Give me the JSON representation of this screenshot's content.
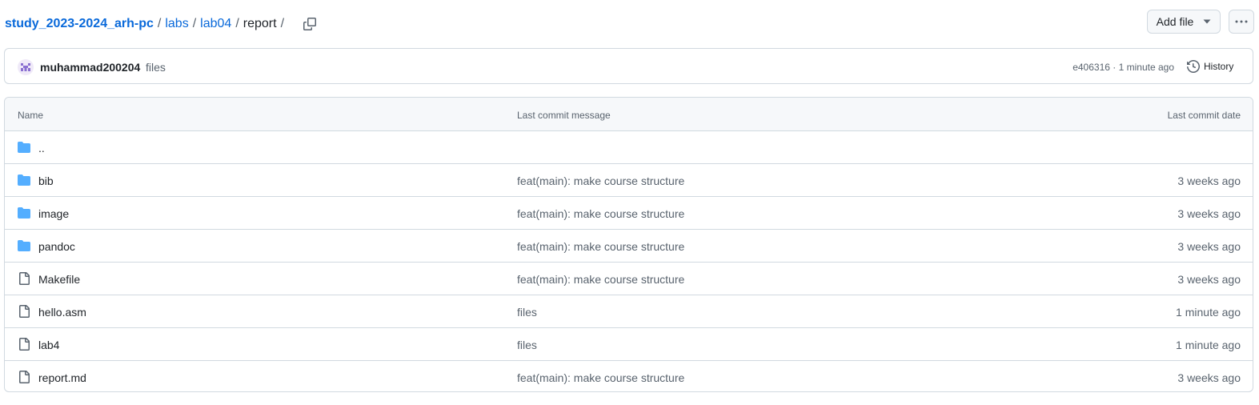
{
  "breadcrumb": {
    "repo": "study_2023-2024_arh-pc",
    "segments": [
      "labs",
      "lab04"
    ],
    "current": "report",
    "separator": "/",
    "trailing_separator": "/"
  },
  "toolbar": {
    "add_file_label": "Add file"
  },
  "commit": {
    "author": "muhammad200204",
    "message": "files",
    "sha": "e406316",
    "separator": "·",
    "time": "1 minute ago",
    "history_label": "History"
  },
  "table": {
    "columns": {
      "name": "Name",
      "message": "Last commit message",
      "date": "Last commit date"
    },
    "rows": [
      {
        "type": "folder",
        "name": "..",
        "message": "",
        "date": ""
      },
      {
        "type": "folder",
        "name": "bib",
        "message": "feat(main): make course structure",
        "date": "3 weeks ago"
      },
      {
        "type": "folder",
        "name": "image",
        "message": "feat(main): make course structure",
        "date": "3 weeks ago"
      },
      {
        "type": "folder",
        "name": "pandoc",
        "message": "feat(main): make course structure",
        "date": "3 weeks ago"
      },
      {
        "type": "file",
        "name": "Makefile",
        "message": "feat(main): make course structure",
        "date": "3 weeks ago"
      },
      {
        "type": "file",
        "name": "hello.asm",
        "message": "files",
        "date": "1 minute ago"
      },
      {
        "type": "file",
        "name": "lab4",
        "message": "files",
        "date": "1 minute ago"
      },
      {
        "type": "file",
        "name": "report.md",
        "message": "feat(main): make course structure",
        "date": "3 weeks ago"
      }
    ]
  },
  "icons": {
    "folder": "folder-icon",
    "file": "file-icon",
    "copy": "copy-icon",
    "history": "history-icon",
    "caret": "caret-down-icon",
    "more": "kebab-horizontal-icon"
  },
  "colors": {
    "link": "#0969da",
    "folder": "#54aeff",
    "muted": "#59636e",
    "border": "#d1d9e0",
    "header_bg": "#f6f8fa"
  }
}
